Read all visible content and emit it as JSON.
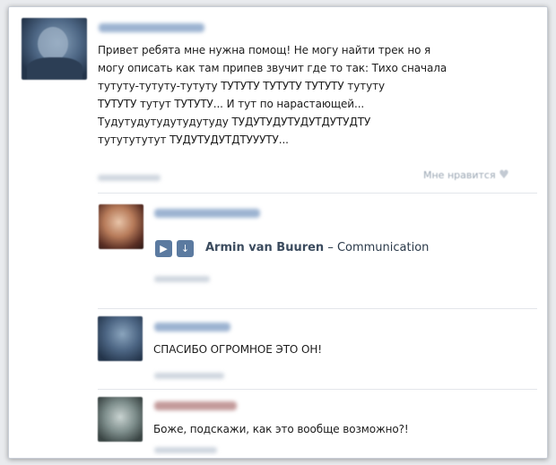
{
  "post": {
    "message_lines": [
      "Привет ребята мне нужна помощ! Не могу найти трек но я",
      "могу описать как там припев звучит где то так: Тихо сначала",
      "тутуту-тутуту-тутуту ТУТУТУ ТУТУТУ ТУТУТУ тутуту",
      "ТУТУТУ тутут ТУТУТУ... И тут по нарастающей...",
      "Тудутудутудутудутуду ТУДУТУДУТУДУТДУТУДТУ",
      "тутутутутут ТУДУТУДУТДТУУУТУ..."
    ],
    "like_label": "Мне нравится",
    "like_icon": "heart-icon"
  },
  "comments": [
    {
      "audio": {
        "play_icon": "play-icon",
        "download_icon": "download-arrow-icon",
        "artist": "Armin van Buuren",
        "separator": " – ",
        "title": "Communication"
      }
    },
    {
      "text": "СПАСИБО ОГРОМНОЕ ЭТО ОН!"
    },
    {
      "text": "Боже, подскажи, как это вообще возможно?!"
    }
  ],
  "colors": {
    "accent": "#5b7aa0",
    "link_blurred": "#9cb3d1",
    "text": "#1d1d1d",
    "meta": "#9aa6b3"
  }
}
